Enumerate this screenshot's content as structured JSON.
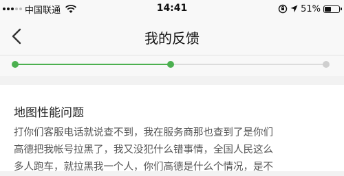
{
  "status_bar": {
    "carrier": "中国联通",
    "time": "14:41",
    "battery_percent": "51%",
    "battery_level": 0.51,
    "icons": [
      "signal-icon",
      "wifi-icon",
      "orientation-lock-icon",
      "location-icon",
      "battery-icon"
    ]
  },
  "nav": {
    "title": "我的反馈",
    "back_icon": "chevron-left-icon"
  },
  "progress": {
    "completed_steps": 2,
    "total_steps": 3,
    "fraction": 0.5,
    "accent_color": "#4cb050",
    "inactive_color": "#cfcfcf"
  },
  "feedback": {
    "title": "地图性能问题",
    "lines": [
      "打你们客服电话就说查不到，我在服务商那也查到了是你们",
      "高德把我帐号拉黑了，我又没犯什么错事情，全国人民这么",
      "多人跑车，就拉黑我一个人，你们高德是什么个情况，是不"
    ]
  }
}
